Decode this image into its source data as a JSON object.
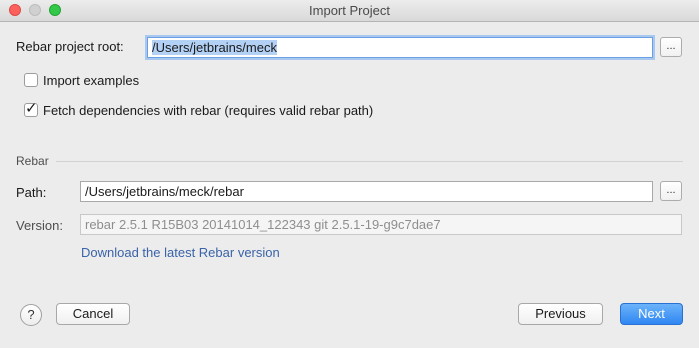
{
  "window": {
    "title": "Import Project"
  },
  "project_root": {
    "label": "Rebar project root:",
    "value": "/Users/jetbrains/meck",
    "browse_label": "..."
  },
  "options": {
    "import_examples": {
      "label": "Import examples",
      "checked": false
    },
    "fetch_dependencies": {
      "label": "Fetch dependencies with rebar (requires valid rebar path)",
      "checked": true,
      "checkmark": "✓"
    }
  },
  "rebar": {
    "section_title": "Rebar",
    "path_label": "Path:",
    "path_value": "/Users/jetbrains/meck/rebar",
    "browse_label": "...",
    "version_label": "Version:",
    "version_value": "rebar 2.5.1 R15B03 20141014_122343 git 2.5.1-19-g9c7dae7",
    "download_link": "Download the latest Rebar version"
  },
  "footer": {
    "help_label": "?",
    "cancel_label": "Cancel",
    "previous_label": "Previous",
    "next_label": "Next"
  }
}
